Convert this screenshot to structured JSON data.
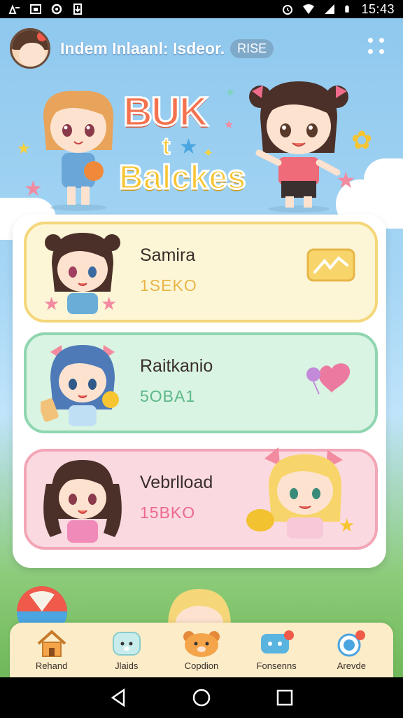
{
  "status_bar": {
    "time": "15:43"
  },
  "header": {
    "title": "Indem Inlaanl: Isdeor.",
    "badge": "RISE"
  },
  "banner": {
    "logo_line1": "BUK",
    "logo_line2": "t",
    "logo_line3": "Balckes"
  },
  "cards": [
    {
      "name": "Samira",
      "score": "1SEKO",
      "score_color": "#e7b548",
      "bg": "#fdf6d6",
      "border": "#f4d77a",
      "action_icon": "zigzag-button-icon"
    },
    {
      "name": "Raitkanio",
      "score": "5OBA1",
      "score_color": "#5cb88a",
      "bg": "#d9f4e2",
      "border": "#8fd6b0",
      "action_icon": "heart-balloon-icon"
    },
    {
      "name": "Vebrlload",
      "score": "15BKO",
      "score_color": "#ec6a8c",
      "bg": "#fbd9e0",
      "border": "#f3a6b6",
      "action_icon": "lemon-icon"
    }
  ],
  "tabs": [
    {
      "label": "Rehand",
      "icon": "home-icon"
    },
    {
      "label": "Jlaids",
      "icon": "bear-face-icon"
    },
    {
      "label": "Copdion",
      "icon": "bear-mascot-icon"
    },
    {
      "label": "Fonsenns",
      "icon": "chat-bubble-icon"
    },
    {
      "label": "Arevde",
      "icon": "balloon-icon"
    }
  ]
}
